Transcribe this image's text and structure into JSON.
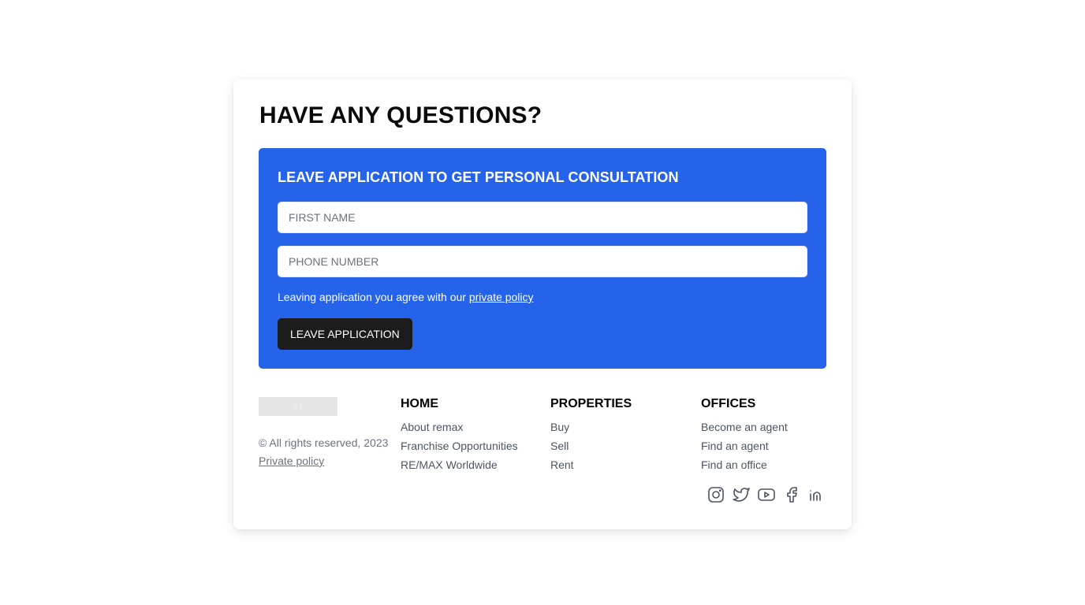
{
  "heading": "HAVE ANY QUESTIONS?",
  "form": {
    "title": "LEAVE APPLICATION TO GET PERSONAL CONSULTATION",
    "first_name_placeholder": "FIRST NAME",
    "phone_placeholder": "PHONE NUMBER",
    "agree_text": "Leaving application you agree with our ",
    "agree_link": "private policy",
    "submit_label": "LEAVE APPLICATION",
    "background_color": "#2563eb",
    "button_color": "#1c1c1c"
  },
  "footer": {
    "copyright": "© All rights reserved, 2023",
    "privacy_link": "Private policy",
    "columns": [
      {
        "title": "HOME",
        "links": [
          "About remax",
          "Franchise Opportunities",
          "RE/MAX Worldwide"
        ]
      },
      {
        "title": "PROPERTIES",
        "links": [
          "Buy",
          "Sell",
          "Rent"
        ]
      },
      {
        "title": "OFFICES",
        "links": [
          "Become an agent",
          "Find an agent",
          "Find an office"
        ]
      }
    ],
    "social_icons": [
      "instagram-icon",
      "twitter-icon",
      "youtube-icon",
      "facebook-icon",
      "linkedin-icon"
    ]
  }
}
